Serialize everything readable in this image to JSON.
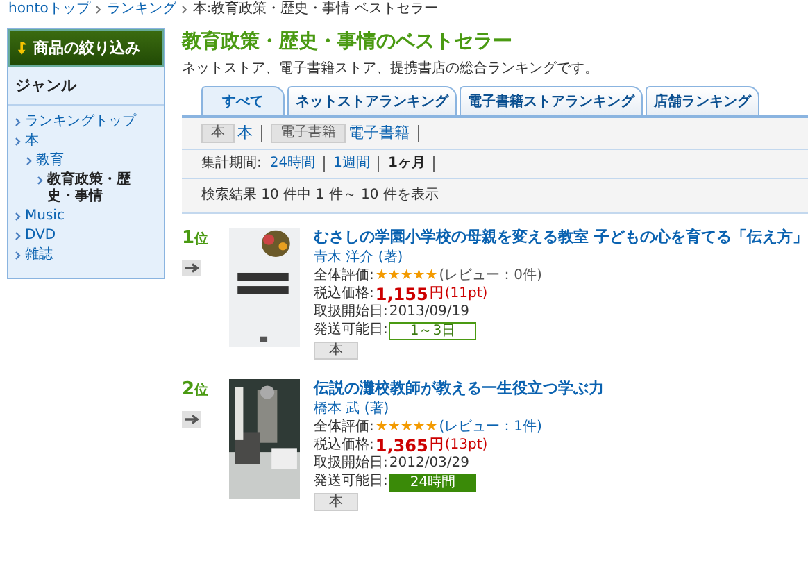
{
  "breadcrumb": [
    {
      "label": "hontoトップ",
      "link": true
    },
    {
      "label": "ランキング",
      "link": true
    },
    {
      "label": "本:教育政策・歴史・事情 ベストセラー",
      "link": false
    }
  ],
  "sidebar": {
    "header": "商品の絞り込み",
    "section": "ジャンル",
    "genres": [
      {
        "label": "ランキングトップ",
        "selected": false
      },
      {
        "label": "本",
        "selected": false,
        "children": [
          {
            "label": "教育",
            "selected": false,
            "children": [
              {
                "label": "教育政策・歴史・事情",
                "selected": true
              }
            ]
          }
        ]
      },
      {
        "label": "Music",
        "selected": false
      },
      {
        "label": "DVD",
        "selected": false
      },
      {
        "label": "雑誌",
        "selected": false
      }
    ]
  },
  "title": "教育政策・歴史・事情のベストセラー",
  "description": "ネットストア、電子書籍ストア、提携書店の総合ランキングです。",
  "tabs": [
    {
      "label": "すべて",
      "selected": true
    },
    {
      "label": "ネットストアランキング",
      "selected": false
    },
    {
      "label": "電子書籍ストアランキング",
      "selected": false
    },
    {
      "label": "店舗ランキング",
      "selected": false
    }
  ],
  "formats": [
    {
      "badge": "本",
      "label": "本"
    },
    {
      "badge": "電子書籍",
      "label": "電子書籍"
    }
  ],
  "period": {
    "label": "集計期間:",
    "options": [
      {
        "label": "24時間",
        "selected": false
      },
      {
        "label": "1週間",
        "selected": false
      },
      {
        "label": "1ヶ月",
        "selected": true
      }
    ]
  },
  "result_count": "検索結果 10 件中 1 件～ 10 件を表示",
  "items": [
    {
      "rank": "1",
      "rank_suffix": "位",
      "title": "むさしの学園小学校の母親を変える教室 子どもの心を育てる「伝え方」",
      "author": "青木 洋介 (著)",
      "rating_label": "全体評価:",
      "stars": 5,
      "reviews": "(レビュー：0件)",
      "reviews_link": false,
      "price_label": "税込価格:",
      "price": "1,155",
      "currency": "円",
      "points": "(11pt)",
      "date_label": "取扱開始日:",
      "date": "2013/09/19",
      "shipping_label": "発送可能日:",
      "shipping": "1～3日",
      "shipping_filled": false,
      "format": "本"
    },
    {
      "rank": "2",
      "rank_suffix": "位",
      "title": "伝説の灘校教師が教える一生役立つ学ぶ力",
      "author": "橋本 武 (著)",
      "rating_label": "全体評価:",
      "stars": 5,
      "reviews": "(レビュー：1件)",
      "reviews_link": true,
      "price_label": "税込価格:",
      "price": "1,365",
      "currency": "円",
      "points": "(13pt)",
      "date_label": "取扱開始日:",
      "date": "2012/03/29",
      "shipping_label": "発送可能日:",
      "shipping": "24時間",
      "shipping_filled": true,
      "format": "本"
    }
  ]
}
